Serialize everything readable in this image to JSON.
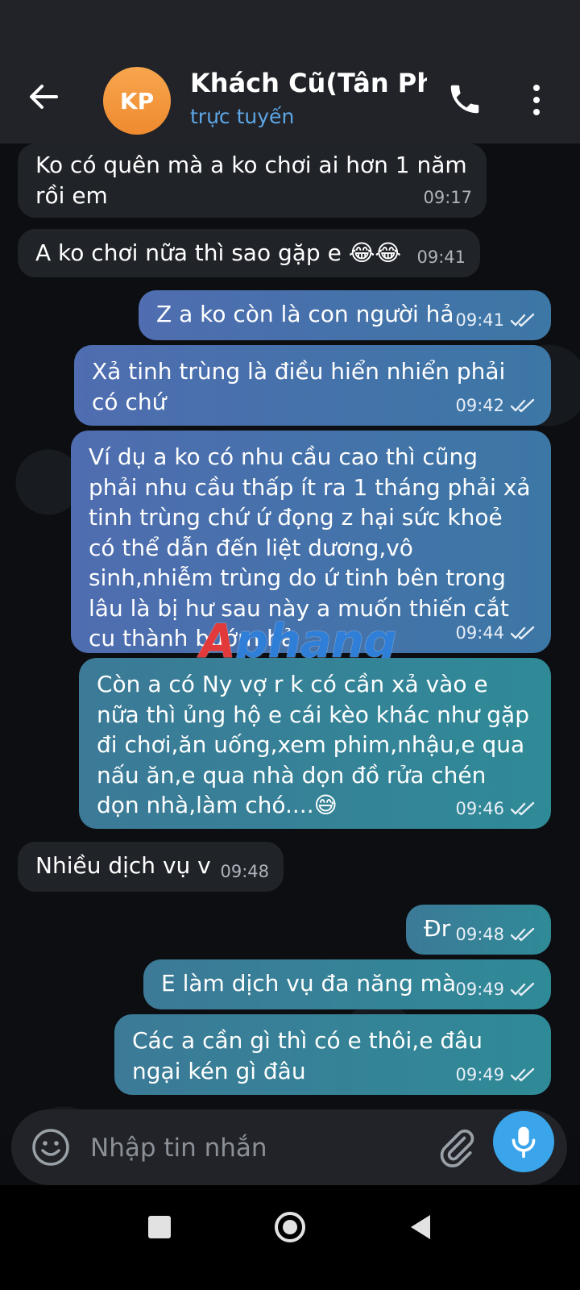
{
  "header": {
    "avatar_initials": "KP",
    "contact_name": "Khách Cũ(Tân Phú",
    "status": "trực tuyến",
    "avatar_color": "#f39a3f",
    "status_color": "#5da6e6"
  },
  "messages": [
    {
      "direction": "in",
      "text": "Ko có quên mà a ko chơi ai hơn 1 năm rồi em",
      "time": "09:17"
    },
    {
      "direction": "in",
      "text": "A ko chơi nữa thì sao gặp e 😂😂",
      "time": "09:41"
    },
    {
      "direction": "out",
      "text": "Z a ko còn là con người hả",
      "time": "09:41",
      "read": true
    },
    {
      "direction": "out",
      "text": "Xả tinh trùng là điều hiển nhiển phải có chứ",
      "time": "09:42",
      "read": true
    },
    {
      "direction": "out",
      "text": "Ví dụ a ko có nhu cầu cao thì cũng phải nhu cầu thấp ít ra 1 tháng phải xả tinh trùng chứ ứ đọng z hại sức khoẻ có thể dẫn đến liệt dương,vô sinh,nhiễm trùng do ứ tinh bên trong lâu là bị hư sau này a muốn thiến cắt cu thành bướm hả",
      "time": "09:44",
      "read": true
    },
    {
      "direction": "out",
      "text": "Còn a có Ny vợ r k có cần xả vào e nữa thì ủng hộ e cái kèo khác như gặp đi chơi,ăn uống,xem phim,nhậu,e qua nấu ăn,e qua nhà dọn đồ rửa chén dọn nhà,làm chó....😅",
      "time": "09:46",
      "read": true
    },
    {
      "direction": "in",
      "text": "Nhiều dịch vụ v",
      "time": "09:48"
    },
    {
      "direction": "out",
      "text": "Đr",
      "time": "09:48",
      "read": true
    },
    {
      "direction": "out",
      "text": "E làm dịch vụ đa năng mà",
      "time": "09:49",
      "read": true
    },
    {
      "direction": "out",
      "text": "Các a cần gì thì có e thôi,e đâu ngại kén gì đâu",
      "time": "09:49",
      "read": true
    }
  ],
  "watermark": "Aphang",
  "composer": {
    "placeholder": "Nhập tin nhắn"
  },
  "icons": {
    "back": "arrow-left-icon",
    "call": "phone-icon",
    "menu": "more-vertical-icon",
    "emoji": "smile-icon",
    "attach": "paperclip-icon",
    "mic": "microphone-icon",
    "read_receipt": "double-check-icon"
  },
  "colors": {
    "mic_button": "#3aa5ea",
    "incoming_bubble": "#202328",
    "outgoing_bubble": "#4f6db0"
  }
}
